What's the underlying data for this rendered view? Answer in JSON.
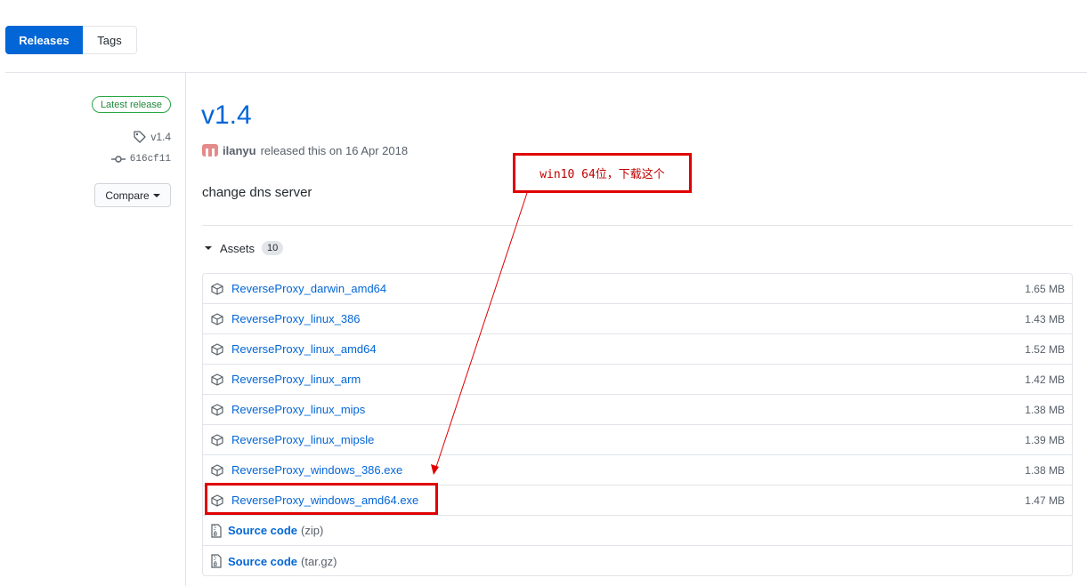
{
  "tabs": [
    {
      "label": "Releases",
      "active": true
    },
    {
      "label": "Tags",
      "active": false
    }
  ],
  "sidebar": {
    "badge": "Latest release",
    "tag": "v1.4",
    "commit": "616cf11",
    "compare_label": "Compare"
  },
  "release": {
    "title": "v1.4",
    "author": "ilanyu",
    "released_text": "released this on 16 Apr 2018",
    "description": "change dns server"
  },
  "assets": {
    "label": "Assets",
    "count": "10",
    "files": [
      {
        "name": "ReverseProxy_darwin_amd64",
        "size": "1.65 MB"
      },
      {
        "name": "ReverseProxy_linux_386",
        "size": "1.43 MB"
      },
      {
        "name": "ReverseProxy_linux_amd64",
        "size": "1.52 MB"
      },
      {
        "name": "ReverseProxy_linux_arm",
        "size": "1.42 MB"
      },
      {
        "name": "ReverseProxy_linux_mips",
        "size": "1.38 MB"
      },
      {
        "name": "ReverseProxy_linux_mipsle",
        "size": "1.39 MB"
      },
      {
        "name": "ReverseProxy_windows_386.exe",
        "size": "1.38 MB"
      },
      {
        "name": "ReverseProxy_windows_amd64.exe",
        "size": "1.47 MB"
      }
    ],
    "sources": [
      {
        "label": "Source code",
        "format": "(zip)"
      },
      {
        "label": "Source code",
        "format": "(tar.gz)"
      }
    ]
  },
  "annotation": {
    "note": "win10 64位，下载这个"
  },
  "colors": {
    "accent": "#0366d6",
    "annotation_red": "#e00000",
    "badge_green": "#28a745"
  }
}
